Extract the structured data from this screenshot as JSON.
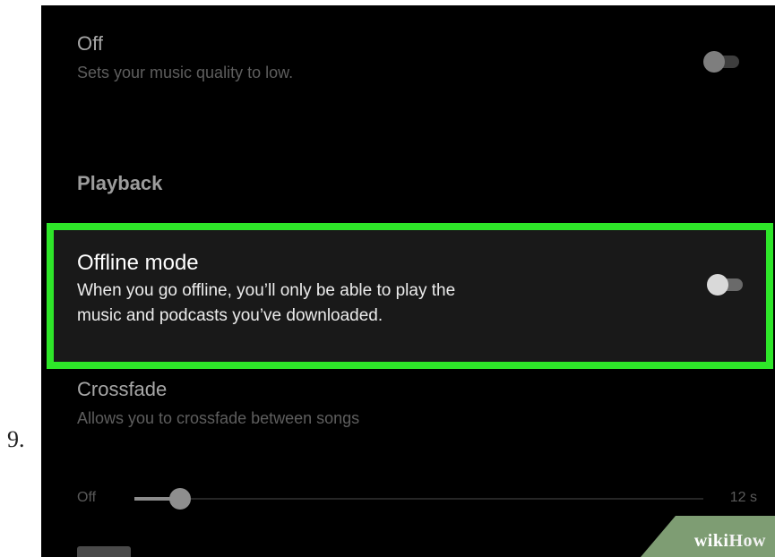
{
  "step_number": "9.",
  "settings": {
    "low_quality": {
      "title": "Off",
      "description": "Sets your music quality to low.",
      "enabled": false
    },
    "playback_header": "Playback",
    "offline_mode": {
      "title": "Offline mode",
      "description_line1": "When you go offline, you’ll only be able to play the",
      "description_line2": "music and podcasts you’ve downloaded.",
      "enabled": false
    },
    "crossfade": {
      "title": "Crossfade",
      "description": "Allows you to crossfade between songs",
      "slider": {
        "min_label": "Off",
        "max_label": "12 s",
        "value_fraction": 0.08
      }
    }
  },
  "colors": {
    "highlight": "#2ee629",
    "background": "#000000"
  },
  "watermark": {
    "part1": "wiki",
    "part2": "How"
  }
}
